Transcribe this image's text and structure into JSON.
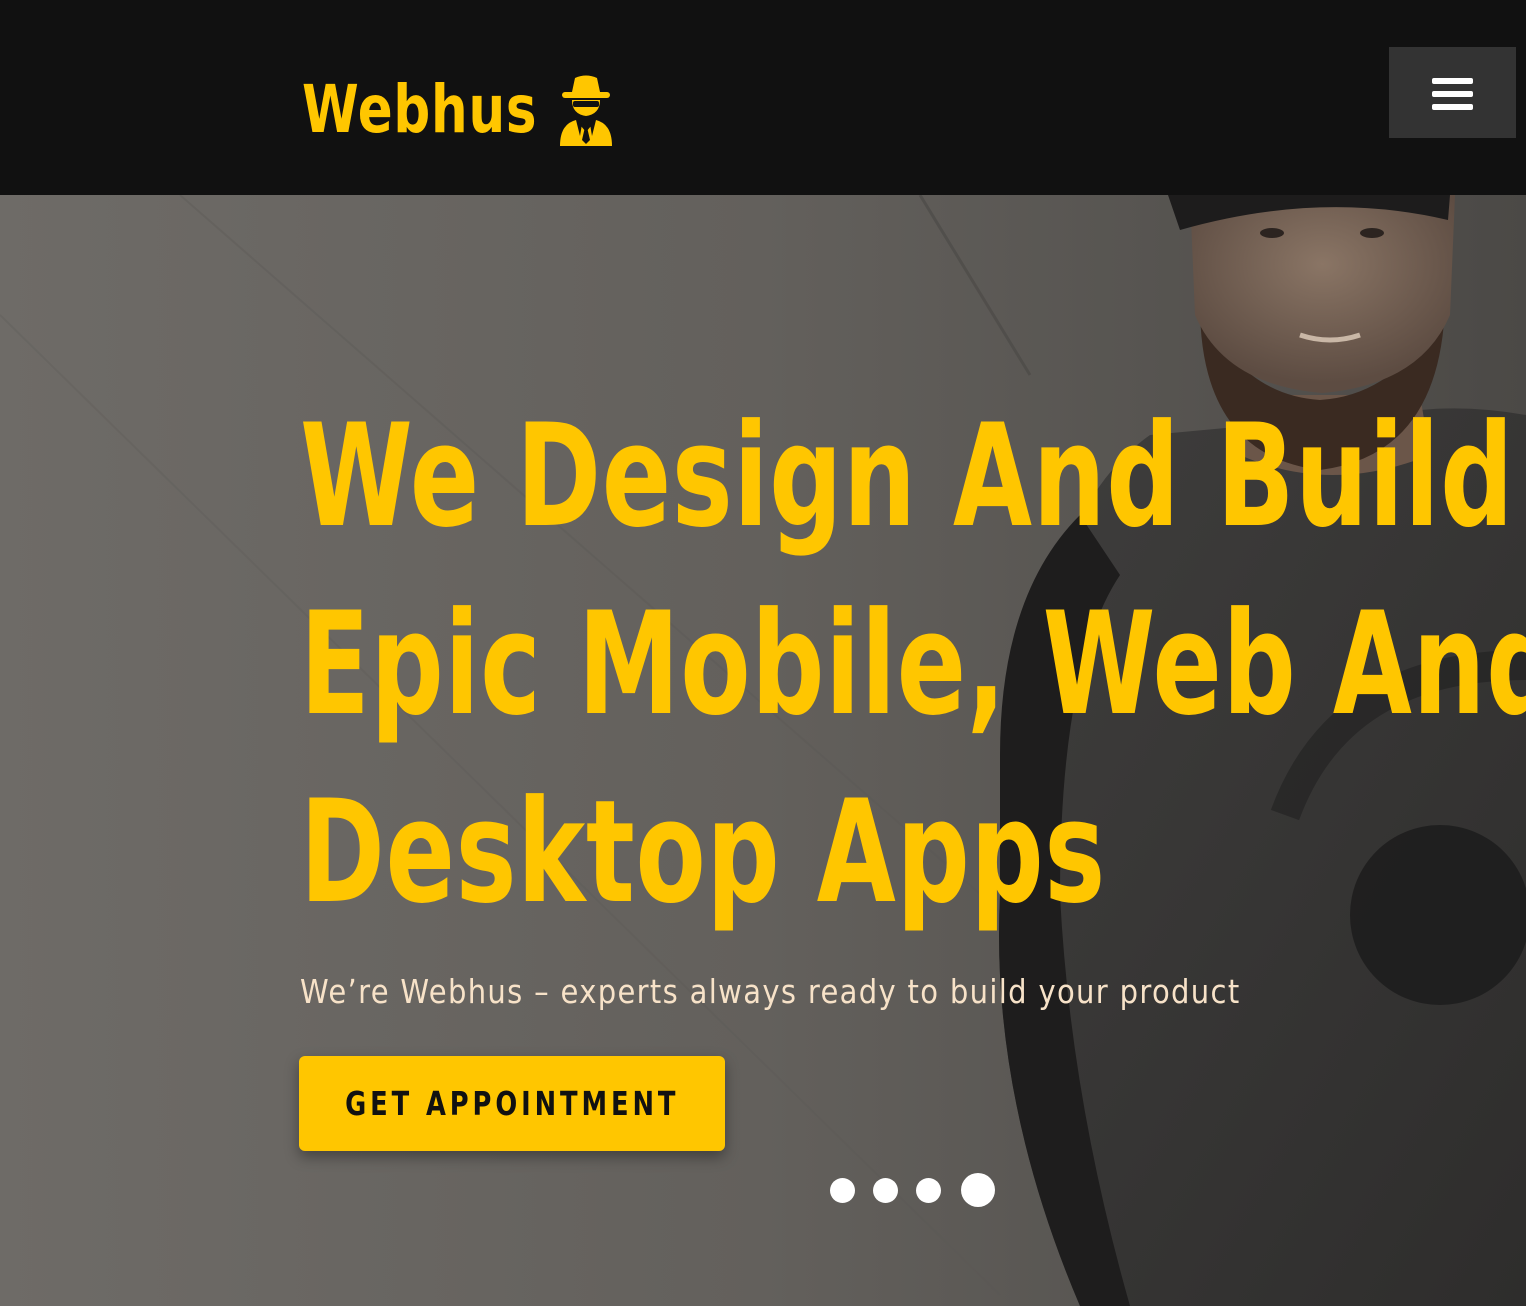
{
  "header": {
    "logo_text": "Webhus",
    "logo_icon": "spy-icon",
    "menu_icon": "hamburger-menu-icon"
  },
  "hero": {
    "title_lines": [
      "We Design And Build",
      "Epic Mobile, Web And",
      "Desktop Apps"
    ],
    "subtitle": "We’re Webhus – experts always ready to build your product",
    "cta_label": "GET APPOINTMENT",
    "slider": {
      "count": 4,
      "active_index": 3
    }
  },
  "colors": {
    "accent": "#FFC600",
    "header_bg": "#111111",
    "menu_button_bg": "#333333",
    "subtitle_text": "#F7E2C8",
    "dot": "#FFFFFF"
  }
}
